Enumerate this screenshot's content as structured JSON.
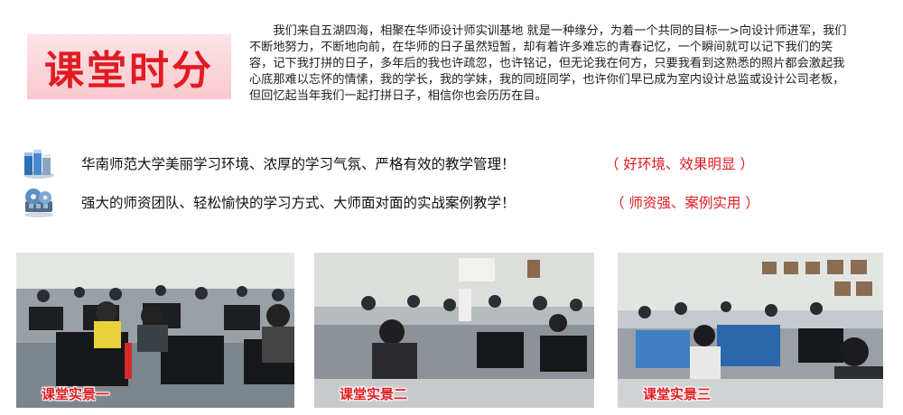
{
  "header": {
    "title": "课堂时分",
    "intro": "我们来自五湖四海，相聚在华师设计师实训基地 就是一种缘分，为着一个共同的目标一>向设计师进军，我们不断地努力，不断地向前，在华师的日子虽然短暂，却有着许多难忘的青春记忆，一个瞬间就可以记下我们的笑容，记下我打拼的日子，多年后的我也许疏忽，也许铭记，但无论我在何方，只要我看到这熟悉的照片都会激起我心底那难以忘怀的情愫，我的学长，我的学妹，我的同班同学，也许你们早已成为室内设计总监或设计公司老板，但回忆起当年我们一起打拼日子，相信你也会历历在目。"
  },
  "features": [
    {
      "icon": "books-icon",
      "text": "华南师范大学美丽学习环境、浓厚的学习气氛、严格有效的教学管理！",
      "tag": "（ 好环境、效果明显 ）"
    },
    {
      "icon": "film-reel-icon",
      "text": "强大的师资团队、轻松愉快的学习方式、大师面对面的实战案例教学！",
      "tag": "（ 师资强、案例实用 ）"
    }
  ],
  "photos": [
    {
      "caption": "课堂实景一"
    },
    {
      "caption": "课堂实景二"
    },
    {
      "caption": "课堂实景三"
    }
  ],
  "colors": {
    "accent_red": "#e11b22",
    "title_bg": "#f8c9cf",
    "text": "#222222"
  }
}
